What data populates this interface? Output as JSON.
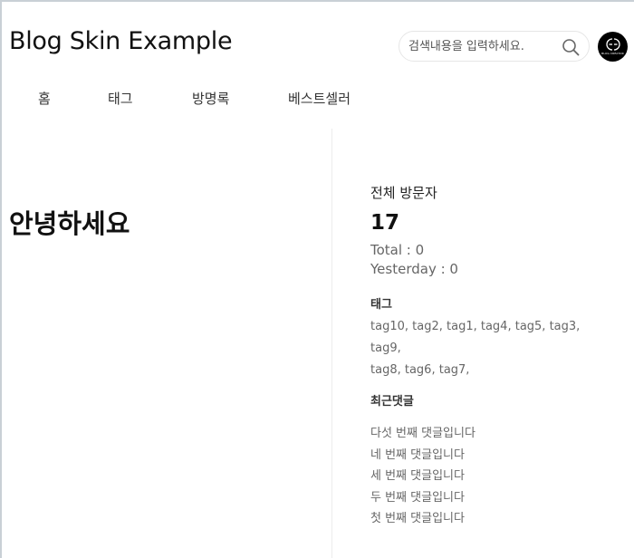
{
  "header": {
    "site_title": "Blog Skin Example",
    "search_placeholder": "검색내용을 입력하세요.",
    "search_value": "",
    "avatar_text": "BLOG CREATOR"
  },
  "nav": {
    "items": [
      {
        "label": "홈"
      },
      {
        "label": "태그"
      },
      {
        "label": "방명록"
      },
      {
        "label": "베스트셀러"
      }
    ]
  },
  "main": {
    "headline": "안녕하세요"
  },
  "sidebar": {
    "visitors": {
      "title": "전체 방문자",
      "count": "17",
      "total": "Total : 0",
      "yesterday": "Yesterday : 0"
    },
    "tags": {
      "title": "태그",
      "items": [
        "tag10,",
        "tag2,",
        "tag1,",
        "tag4,",
        "tag5,",
        "tag3,",
        "tag9,",
        "tag8,",
        "tag6,",
        "tag7,"
      ]
    },
    "recent_comments": {
      "title": "최근댓글",
      "items": [
        "다섯 번째 댓글입니다",
        "네 번째 댓글입니다",
        "세 번째 댓글입니다",
        "두 번째 댓글입니다",
        "첫 번째 댓글입니다"
      ]
    }
  },
  "colors": {
    "text_dark": "#111111",
    "text_muted": "#666666",
    "border": "#e6e6e6",
    "avatar_bg": "#000000"
  },
  "icons": {
    "search": "search-icon",
    "avatar_logo": "blog-creator-logo-icon"
  }
}
